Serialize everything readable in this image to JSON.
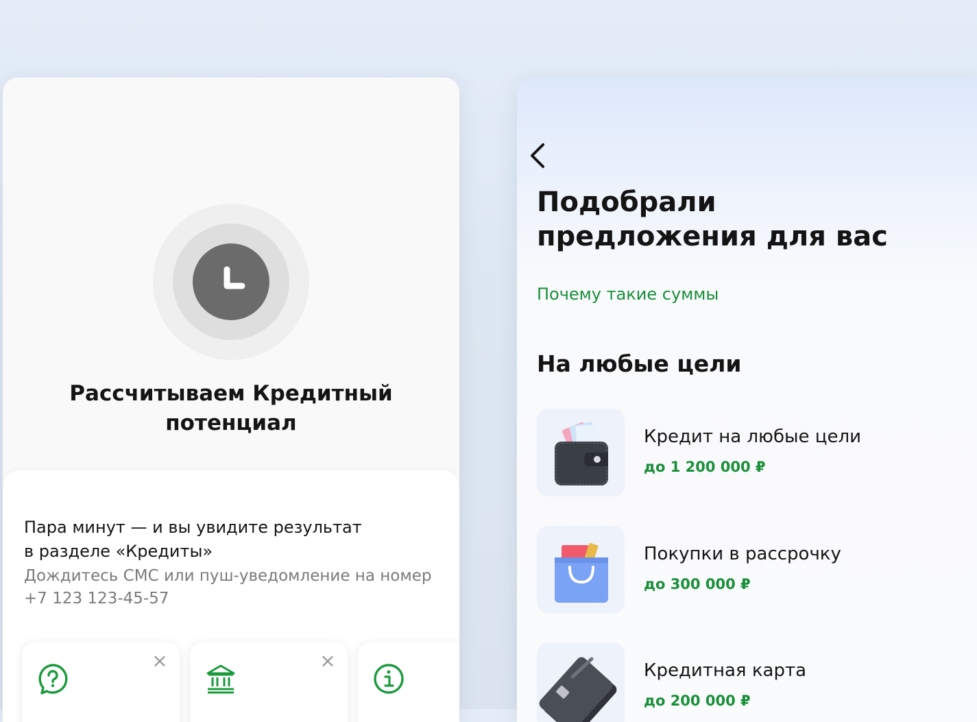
{
  "left_screen": {
    "status_title_line1": "Рассчитываем Кредитный",
    "status_title_line2": "потенциал",
    "main_text_line1": "Пара минут — и вы увидите результат",
    "main_text_line2": "в разделе «Кредиты»",
    "sub_text_line1": "Дождитесь СМС или пуш-уведомление на номер",
    "sub_text_line2": "+7 123 123-45-57",
    "cards": [
      {
        "icon": "question-chat-icon",
        "close": "×"
      },
      {
        "icon": "bank-icon",
        "close": "×"
      },
      {
        "icon": "info-icon"
      }
    ]
  },
  "right_screen": {
    "title_line1": "Подобрали",
    "title_line2": "предложения для вас",
    "why_link": "Почему такие суммы",
    "section_title": "На любые цели",
    "offers": [
      {
        "name": "Кредит на любые цели",
        "amount": "до 1 200 000 ₽",
        "icon": "wallet-icon"
      },
      {
        "name": "Покупки в рассрочку",
        "amount": "до 300 000 ₽",
        "icon": "shopping-bag-icon"
      },
      {
        "name": "Кредитная карта",
        "amount": "до 200 000 ₽",
        "icon": "credit-card-icon"
      }
    ]
  },
  "colors": {
    "accent_green": "#1a8f3a",
    "clock_dark": "#6b6b6b"
  }
}
